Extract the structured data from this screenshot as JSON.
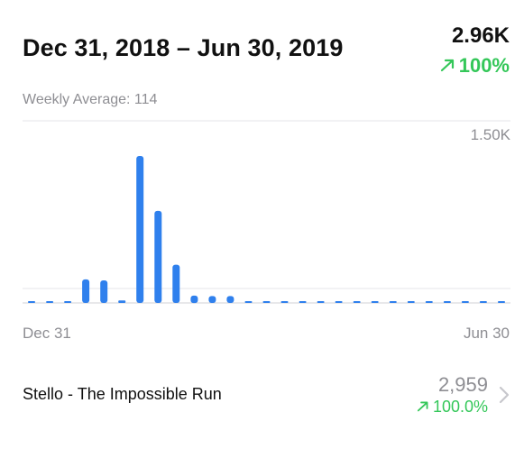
{
  "header": {
    "date_range": "Dec 31, 2018 – Jun 30, 2019",
    "total": "2.96K",
    "total_change": "100%"
  },
  "weekly_average": "Weekly Average: 114",
  "app_row": {
    "name": "Stello - The Impossible Run",
    "value": "2,959",
    "change": "100.0%"
  },
  "colors": {
    "bar": "#2f80ed",
    "positive": "#34c759",
    "muted": "#8e8e93",
    "grid": "#e5e5ea"
  },
  "chart_data": {
    "type": "bar",
    "ytick_top": "1.50K",
    "ylim": [
      0,
      1500
    ],
    "x_start_label": "Dec 31",
    "x_end_label": "Jun 30",
    "values": [
      0,
      0,
      0,
      240,
      230,
      25,
      1500,
      940,
      390,
      75,
      70,
      70,
      18,
      12,
      18,
      10,
      8,
      8,
      8,
      6,
      8,
      6,
      5,
      5,
      4,
      4,
      4
    ],
    "grid": true
  }
}
